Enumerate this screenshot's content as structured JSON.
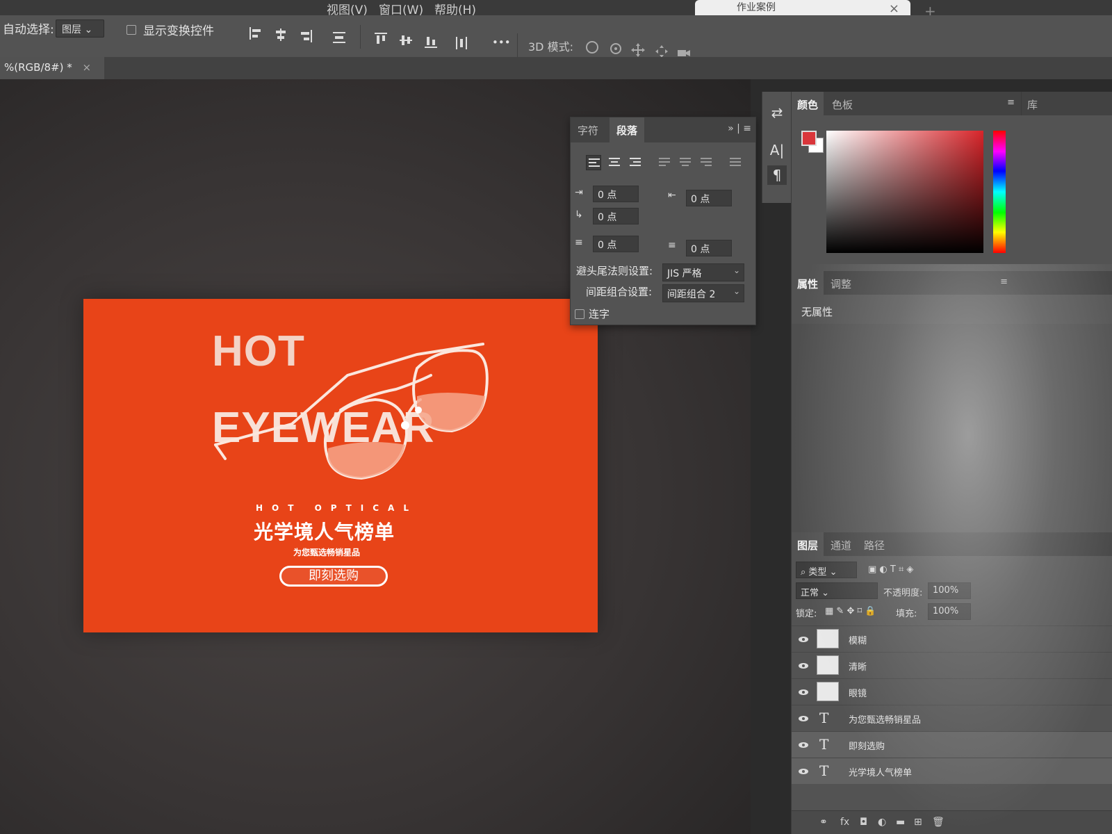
{
  "menu": {
    "items": [
      "视图(V)",
      "窗口(W)",
      "帮助(H)"
    ],
    "browser_tab": "作业案例"
  },
  "options_bar": {
    "auto_select_label": "自动选择:",
    "auto_select_value": "图层",
    "show_transform_label": "显示变换控件",
    "more_label": "•••",
    "mode_3d_label": "3D 模式:"
  },
  "document": {
    "tab_label": "%(RGB/8#) *",
    "close_glyph": "×"
  },
  "artwork": {
    "hot": "HOT",
    "eyewear": "EYEWEAR",
    "hot_optical": "HOT OPTICAL",
    "cn_title": "光学境人气榜单",
    "cn_subtitle": "为您甄选畅销星品",
    "cta": "即刻选购",
    "background_color": "#e84418"
  },
  "paragraph_panel": {
    "tabs": [
      "字符",
      "段落"
    ],
    "active_tab": "段落",
    "left_indent": "0 点",
    "right_indent": "0 点",
    "first_line_indent": "0 点",
    "space_before": "0 点",
    "space_after": "0 点",
    "kinsoku_label": "避头尾法则设置:",
    "kinsoku_value": "JIS 严格",
    "mojikumi_label": "间距组合设置:",
    "mojikumi_value": "间距组合 2",
    "hyphenate_label": "连字"
  },
  "color_panel": {
    "tabs": [
      "颜色",
      "色板"
    ],
    "active_tab": "颜色",
    "foreground": "#d9363b",
    "background": "#ffffff",
    "library_tab": "库"
  },
  "properties_panel": {
    "tabs": [
      "属性",
      "调整"
    ],
    "active_tab": "属性",
    "empty_text": "无属性"
  },
  "layers_panel": {
    "tabs": [
      "图层",
      "通道",
      "路径"
    ],
    "active_tab": "图层",
    "filter_label": "类型",
    "blend_mode": "正常",
    "opacity_label": "不透明度:",
    "opacity_value": "100%",
    "lock_label": "锁定:",
    "fill_label": "填充:",
    "fill_value": "100%",
    "layers": [
      {
        "name": "模糊",
        "kind": "image"
      },
      {
        "name": "清晰",
        "kind": "image"
      },
      {
        "name": "眼镜",
        "kind": "smart"
      },
      {
        "name": "为您甄选畅销星品",
        "kind": "text"
      },
      {
        "name": "即刻选购",
        "kind": "text"
      },
      {
        "name": "光学境人气榜单",
        "kind": "text"
      }
    ]
  }
}
